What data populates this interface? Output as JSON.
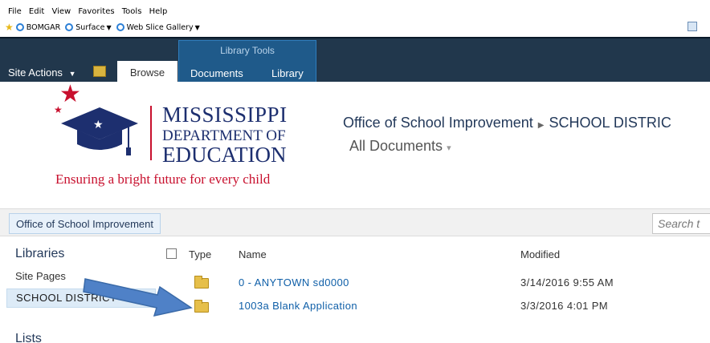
{
  "ie_menu": [
    "File",
    "Edit",
    "View",
    "Favorites",
    "Tools",
    "Help"
  ],
  "favorites": [
    {
      "label": "BOMGAR",
      "icon": "ie-icon"
    },
    {
      "label": "Surface",
      "icon": "ie-icon",
      "dropdown": true
    },
    {
      "label": "Web Slice Gallery",
      "icon": "ie-icon",
      "dropdown": true
    }
  ],
  "ribbon": {
    "site_actions": "Site Actions",
    "browse": "Browse",
    "library_tools": "Library Tools",
    "documents": "Documents",
    "library": "Library"
  },
  "logo": {
    "line1": "MISSISSIPPI",
    "line2": "DEPARTMENT OF",
    "line3": "EDUCATION",
    "tagline": "Ensuring a bright future for every child"
  },
  "header": {
    "site": "Office of School Improvement",
    "current": "SCHOOL DISTRIC",
    "view": "All Documents"
  },
  "topbar": {
    "link": "Office of School Improvement",
    "search_placeholder": "Search t"
  },
  "quick_launch": {
    "libraries": "Libraries",
    "site_pages": "Site Pages",
    "school_district": "SCHOOL DISTRICT",
    "lists": "Lists"
  },
  "columns": {
    "type": "Type",
    "name": "Name",
    "modified": "Modified"
  },
  "rows": [
    {
      "name": "0 - ANYTOWN sd0000",
      "modified": "3/14/2016 9:55 AM"
    },
    {
      "name": "1003a Blank Application",
      "modified": "3/3/2016 4:01 PM"
    }
  ],
  "colors": {
    "ribbon": "#21374c",
    "library_tools": "#1f5a8a",
    "link": "#0f5fa8",
    "logo_blue": "#1d2f6f",
    "logo_red": "#c8102e"
  }
}
